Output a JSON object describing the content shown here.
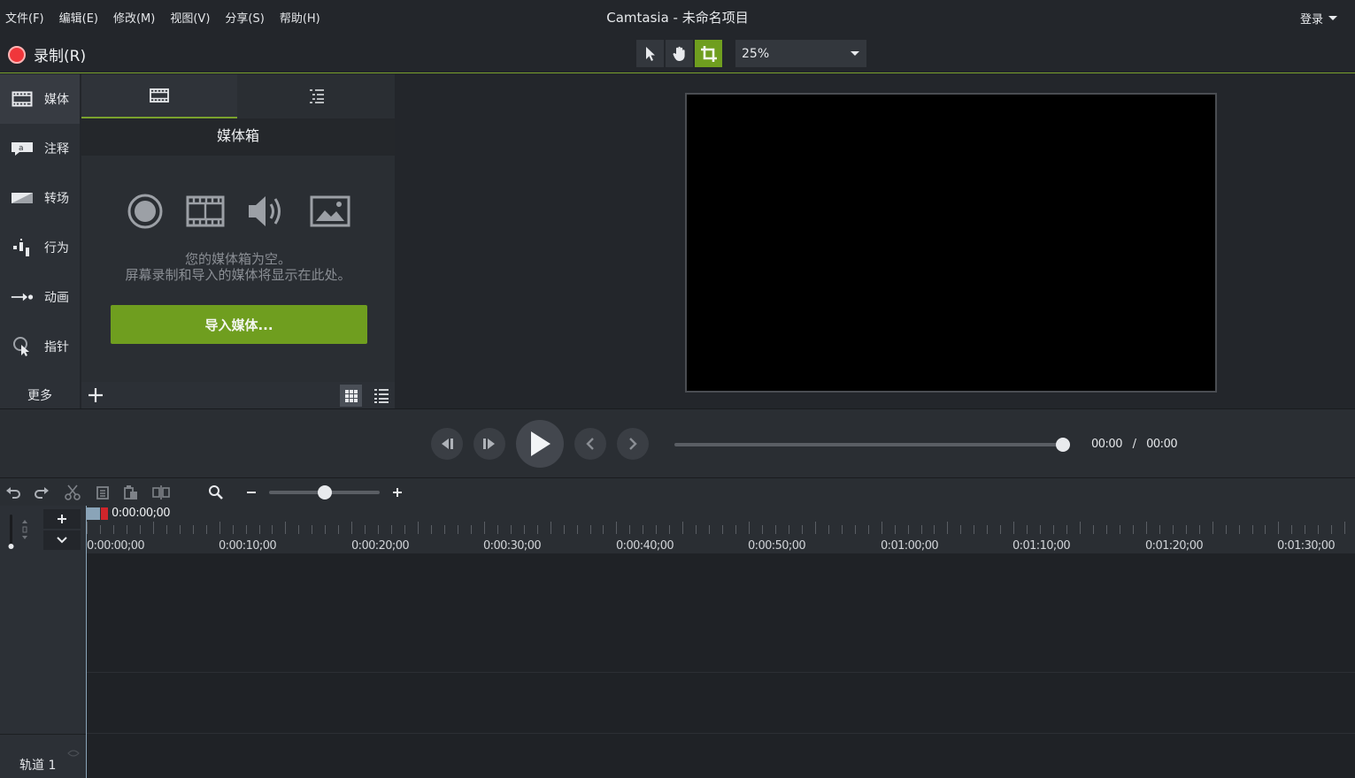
{
  "window": {
    "title": "Camtasia - 未命名项目",
    "login_label": "登录"
  },
  "menu": [
    {
      "label": "文件(F)"
    },
    {
      "label": "编辑(E)"
    },
    {
      "label": "修改(M)"
    },
    {
      "label": "视图(V)"
    },
    {
      "label": "分享(S)"
    },
    {
      "label": "帮助(H)"
    }
  ],
  "toolbar": {
    "record_label": "录制(R)",
    "zoom_value": "25%",
    "tools": [
      "select-arrow-icon",
      "pan-hand-icon",
      "crop-icon"
    ],
    "active_tool": "crop-icon",
    "accent_color": "#6f9e1f"
  },
  "sidebar": {
    "items": [
      {
        "label": "媒体",
        "icon": "film-icon"
      },
      {
        "label": "注释",
        "icon": "annotation-icon"
      },
      {
        "label": "转场",
        "icon": "transition-icon"
      },
      {
        "label": "行为",
        "icon": "behavior-icon"
      },
      {
        "label": "动画",
        "icon": "animation-icon"
      },
      {
        "label": "指针",
        "icon": "cursor-effect-icon"
      }
    ],
    "more_label": "更多"
  },
  "media_panel": {
    "title": "媒体箱",
    "empty_line1": "您的媒体箱为空。",
    "empty_line2": "屏幕录制和导入的媒体将显示在此处。",
    "import_button": "导入媒体..."
  },
  "playback": {
    "current_time": "00:00",
    "separator": "/",
    "total_time": "00:00"
  },
  "timeline": {
    "playhead_time": "0:00:00;00",
    "ruler_labels": [
      "0:00:00;00",
      "0:00:10;00",
      "0:00:20;00",
      "0:00:30;00",
      "0:00:40;00",
      "0:00:50;00",
      "0:01:00;00",
      "0:01:10;00",
      "0:01:20;00",
      "0:01:30;00"
    ],
    "track_label": "轨道 1"
  }
}
